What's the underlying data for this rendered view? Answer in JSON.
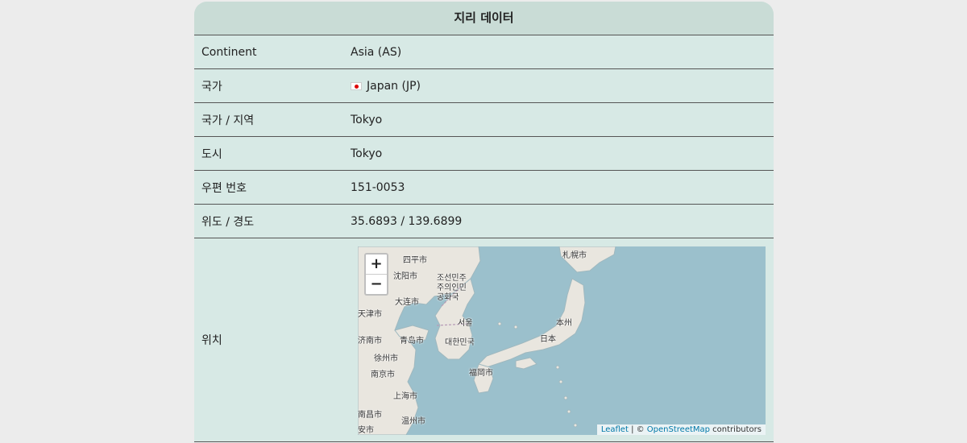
{
  "title": "지리 데이터",
  "rows": [
    {
      "label": "Continent",
      "value": "Asia (AS)"
    },
    {
      "label": "국가",
      "value": "Japan (JP)"
    },
    {
      "label": "국가 / 지역",
      "value": "Tokyo"
    },
    {
      "label": "도시",
      "value": "Tokyo"
    },
    {
      "label": "우편 번호",
      "value": "151-0053"
    },
    {
      "label": "위도 / 경도",
      "value": "35.6893 / 139.6899"
    }
  ],
  "location": {
    "label": "위치",
    "map": {
      "zoom_in": "+",
      "zoom_out": "−",
      "place_labels": [
        "四平市",
        "沈阳市",
        "大连市",
        "天津市",
        "济南市",
        "青岛市",
        "徐州市",
        "南京市",
        "上海市",
        "南昌市",
        "温州市",
        "安市",
        "조선민주주의인민공화국",
        "서울",
        "대한민국",
        "福岡市",
        "札幌市",
        "本州",
        "日本"
      ],
      "attribution": {
        "leaflet": "Leaflet",
        "separator": " | © ",
        "osm": "OpenStreetMap",
        "suffix": " contributors"
      },
      "colors": {
        "water": "#9bc0cc",
        "land": "#e9e6df",
        "border": "#b79bb7"
      }
    }
  }
}
